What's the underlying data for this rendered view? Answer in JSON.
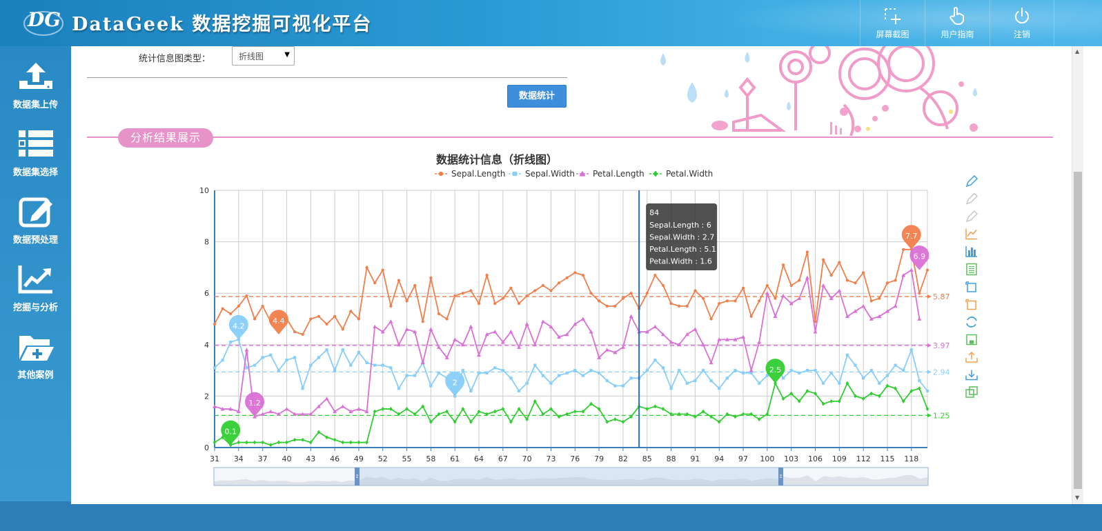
{
  "header": {
    "logo_text": "DG",
    "brand": "DataGeek 数据挖掘可视化平台",
    "buttons": [
      {
        "label": "屏幕截图",
        "icon": "screenshot-icon"
      },
      {
        "label": "用户指南",
        "icon": "hand-pointer-icon"
      },
      {
        "label": "注销",
        "icon": "power-icon"
      }
    ]
  },
  "sidebar": {
    "items": [
      {
        "label": "数据集上传",
        "icon": "upload-icon"
      },
      {
        "label": "数据集选择",
        "icon": "list-icon"
      },
      {
        "label": "数据预处理",
        "icon": "edit-icon"
      },
      {
        "label": "挖掘与分析",
        "icon": "trend-chart-icon"
      },
      {
        "label": "其他案例",
        "icon": "folder-plus-icon"
      }
    ]
  },
  "form": {
    "chart_type_label": "统计信息图类型：",
    "chart_type_value": "折线图",
    "submit_label": "数据统计"
  },
  "section": {
    "title": "分析结果展示"
  },
  "colors": {
    "sepal_length": "#f07f4b",
    "sepal_width": "#87cefa",
    "petal_length": "#da70d6",
    "petal_width": "#32cd32",
    "toolbar_icons": [
      "#3f9fe0",
      "#c7c7c7",
      "#c7c7c7",
      "#f5a04f",
      "#3f9fe0",
      "#5cbf5c",
      "#3f9fe0",
      "#f5a04f",
      "#3f9fe0",
      "#5cbf5c",
      "#f5a04f",
      "#3f9fe0",
      "#5cbf5c"
    ]
  },
  "tooltip": {
    "title": "84",
    "rows": [
      "Sepal.Length : 6",
      "Sepal.Width : 2.7",
      "Petal.Length : 5.1",
      "Petal.Width : 1.6"
    ]
  },
  "chart_data": {
    "type": "line",
    "title": "数据统计信息（折线图）",
    "legend_position": "top-center",
    "grid": true,
    "ylim": [
      0,
      10
    ],
    "yticks": [
      "0",
      "2",
      "4",
      "6",
      "8",
      "10"
    ],
    "x_start": 31,
    "x_end": 120,
    "x_tick_labels": [
      "31",
      "34",
      "37",
      "40",
      "43",
      "46",
      "49",
      "52",
      "55",
      "58",
      "61",
      "64",
      "67",
      "70",
      "73",
      "76",
      "79",
      "82",
      "85",
      "88",
      "91",
      "94",
      "97",
      "100",
      "103",
      "106",
      "109",
      "112",
      "115",
      "118"
    ],
    "hover_x": 84,
    "series": [
      {
        "name": "Sepal.Length",
        "color": "#f07f4b",
        "marker": "circle",
        "mean": 5.87,
        "mean_label": "5.87",
        "max": {
          "x": 118,
          "value": 7.7,
          "label": "7.7"
        },
        "min": {
          "x": 39,
          "value": 4.4,
          "label": "4.4"
        },
        "values": [
          4.8,
          5.4,
          5.2,
          5.5,
          5.9,
          5.0,
          5.5,
          4.9,
          5.1,
          5.0,
          4.5,
          4.4,
          5.0,
          5.1,
          4.8,
          5.1,
          4.6,
          5.3,
          5.0,
          7.0,
          6.4,
          6.9,
          5.5,
          6.5,
          5.7,
          6.3,
          4.9,
          6.6,
          5.2,
          5.0,
          5.9,
          6.0,
          6.1,
          5.6,
          6.7,
          5.6,
          5.8,
          6.2,
          5.6,
          5.9,
          6.1,
          6.3,
          6.1,
          6.4,
          6.6,
          6.8,
          6.7,
          6.0,
          5.7,
          5.5,
          5.5,
          5.8,
          6.0,
          5.4,
          6.0,
          6.7,
          6.3,
          5.6,
          5.5,
          5.5,
          6.1,
          5.8,
          5.0,
          5.6,
          5.7,
          5.7,
          6.2,
          5.1,
          5.7,
          6.3,
          5.8,
          7.1,
          6.3,
          6.5,
          7.6,
          4.9,
          7.3,
          6.7,
          7.2,
          6.5,
          6.4,
          6.8,
          5.7,
          5.8,
          6.4,
          6.5,
          7.7,
          7.7,
          6.0,
          6.9
        ]
      },
      {
        "name": "Sepal.Width",
        "color": "#87cefa",
        "marker": "square",
        "mean": 2.94,
        "mean_label": "2.94",
        "max": {
          "x": 34,
          "value": 4.2,
          "label": "4.2"
        },
        "min": {
          "x": 61,
          "value": 2.0,
          "label": "2"
        },
        "values": [
          3.1,
          3.4,
          4.1,
          4.2,
          3.1,
          3.2,
          3.5,
          3.6,
          3.0,
          3.4,
          3.5,
          2.3,
          3.2,
          3.5,
          3.8,
          3.0,
          3.8,
          3.2,
          3.7,
          3.3,
          3.2,
          3.2,
          3.1,
          2.3,
          2.8,
          2.8,
          3.3,
          2.4,
          2.9,
          2.7,
          2.0,
          3.0,
          2.2,
          2.9,
          2.9,
          3.1,
          3.0,
          2.7,
          2.2,
          2.5,
          3.2,
          2.8,
          2.5,
          2.8,
          2.9,
          3.0,
          2.8,
          3.0,
          2.9,
          2.6,
          2.4,
          2.4,
          2.7,
          2.7,
          3.0,
          3.4,
          3.1,
          2.3,
          3.0,
          2.5,
          2.6,
          3.0,
          2.6,
          2.3,
          2.7,
          3.0,
          2.9,
          2.9,
          2.5,
          2.8,
          3.3,
          2.7,
          3.0,
          2.9,
          3.0,
          3.0,
          2.5,
          2.9,
          2.5,
          3.6,
          3.2,
          2.7,
          3.0,
          2.5,
          2.8,
          3.2,
          3.0,
          3.8,
          2.6,
          2.2
        ]
      },
      {
        "name": "Petal.Length",
        "color": "#da70d6",
        "marker": "triangle",
        "mean": 3.97,
        "mean_label": "3.97",
        "max": {
          "x": 119,
          "value": 6.9,
          "label": "6.9"
        },
        "min": {
          "x": 36,
          "value": 1.2,
          "label": "1.2"
        },
        "values": [
          1.6,
          1.5,
          1.5,
          1.4,
          3.8,
          1.2,
          1.3,
          1.4,
          1.3,
          1.5,
          1.3,
          1.3,
          1.3,
          1.6,
          1.9,
          1.4,
          1.6,
          1.4,
          1.5,
          1.4,
          4.7,
          4.5,
          4.9,
          4.0,
          4.6,
          4.5,
          3.3,
          4.6,
          3.9,
          3.5,
          4.2,
          4.0,
          4.7,
          3.6,
          4.4,
          4.5,
          4.1,
          4.5,
          3.9,
          4.8,
          4.0,
          4.9,
          4.7,
          4.3,
          4.4,
          4.8,
          5.0,
          4.5,
          3.5,
          3.8,
          3.7,
          3.9,
          5.1,
          4.5,
          4.5,
          4.7,
          4.4,
          4.1,
          4.0,
          4.4,
          4.6,
          4.0,
          3.3,
          4.2,
          4.2,
          4.2,
          4.3,
          3.0,
          4.1,
          6.0,
          5.1,
          5.9,
          5.6,
          5.8,
          6.6,
          4.5,
          6.3,
          5.8,
          6.1,
          5.1,
          5.3,
          5.5,
          5.0,
          5.1,
          5.3,
          5.5,
          6.7,
          6.9,
          5.0
        ]
      },
      {
        "name": "Petal.Width",
        "color": "#32cd32",
        "marker": "diamond",
        "mean": 1.25,
        "mean_label": "1.25",
        "max": {
          "x": 101,
          "value": 2.5,
          "label": "2.5"
        },
        "min": {
          "x": 33,
          "value": 0.1,
          "label": "0.1"
        },
        "values": [
          0.2,
          0.4,
          0.1,
          0.2,
          0.2,
          0.2,
          0.2,
          0.1,
          0.2,
          0.2,
          0.3,
          0.3,
          0.2,
          0.6,
          0.4,
          0.3,
          0.2,
          0.2,
          0.2,
          0.2,
          1.4,
          1.5,
          1.5,
          1.3,
          1.5,
          1.3,
          1.6,
          1.0,
          1.3,
          1.4,
          1.0,
          1.5,
          1.0,
          1.4,
          1.3,
          1.4,
          1.5,
          1.0,
          1.5,
          1.1,
          1.8,
          1.3,
          1.5,
          1.2,
          1.3,
          1.4,
          1.4,
          1.7,
          1.5,
          1.0,
          1.1,
          1.0,
          1.2,
          1.6,
          1.5,
          1.6,
          1.5,
          1.3,
          1.3,
          1.3,
          1.2,
          1.4,
          1.2,
          1.0,
          1.3,
          1.2,
          1.3,
          1.3,
          1.1,
          1.3,
          2.5,
          1.9,
          2.1,
          1.8,
          2.2,
          2.1,
          1.7,
          1.8,
          1.8,
          2.5,
          2.0,
          1.9,
          2.1,
          2.0,
          2.4,
          2.3,
          1.8,
          2.2,
          2.3,
          1.5
        ]
      }
    ]
  }
}
